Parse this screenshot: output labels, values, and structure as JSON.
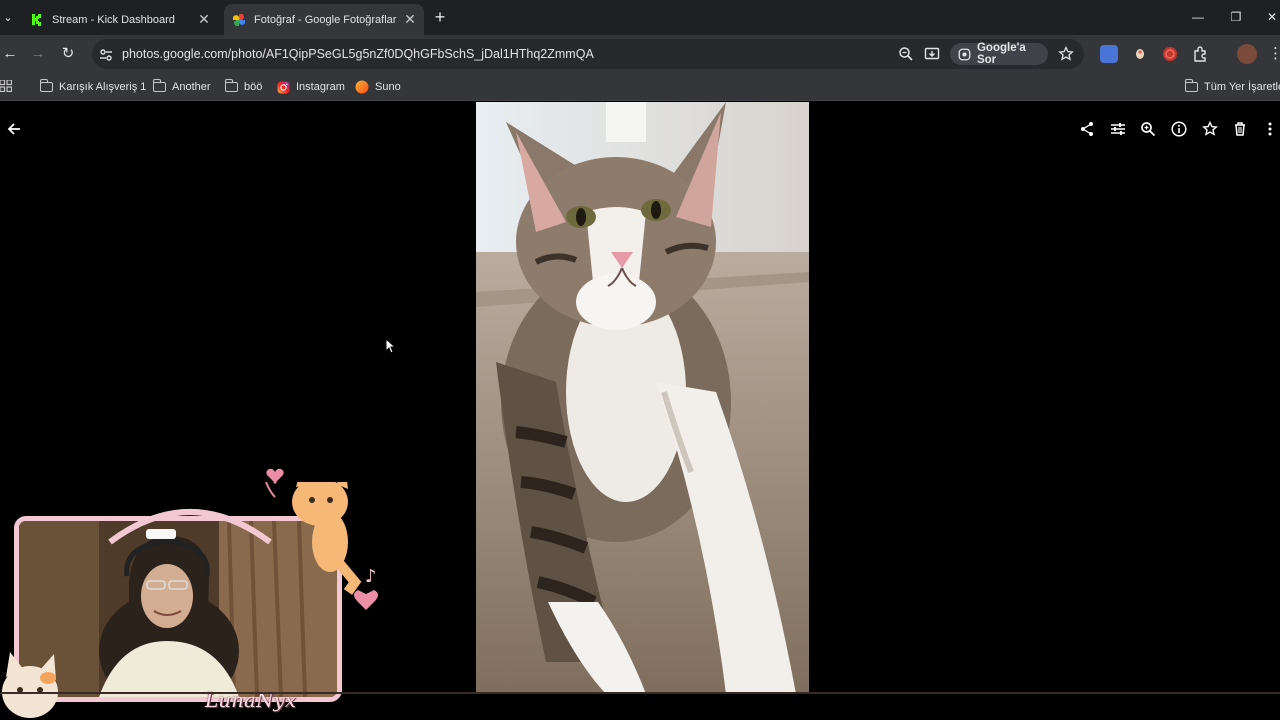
{
  "browser": {
    "tabs": [
      {
        "title": "Stream - Kick Dashboard",
        "active": false
      },
      {
        "title": "Fotoğraf - Google Fotoğraflar",
        "active": true
      }
    ],
    "new_tab_label": "+",
    "url_host": "photos.google.com",
    "url_path": "/photo/AF1QipPSeGL5g5nZf0DQhGFbSchS_jDal1HThq2ZmmQA",
    "ask_google_label": "Google'a Sor",
    "bookmarks": [
      {
        "label": "Karışık Alışveriş 1",
        "icon": "folder-icon"
      },
      {
        "label": "Another",
        "icon": "folder-icon"
      },
      {
        "label": "böö",
        "icon": "folder-icon"
      },
      {
        "label": "Instagram",
        "icon": "instagram-icon"
      },
      {
        "label": "Suno",
        "icon": "suno-icon"
      }
    ],
    "all_bookmarks_label": "Tüm Yer İşaretleri"
  },
  "viewer": {
    "photo_subject": "cat-photo",
    "actions": [
      "share-icon",
      "edit-icon",
      "zoom-icon",
      "info-icon",
      "favorite-icon",
      "delete-icon",
      "more-icon"
    ]
  },
  "overlay": {
    "streamer_name": "LunaNyx"
  },
  "colors": {
    "tab_bar": "#1f2023",
    "toolbar": "#35363a",
    "omnibox": "#28292c",
    "webcam_border": "#f3c8d2",
    "viewer_bg": "#000000"
  }
}
